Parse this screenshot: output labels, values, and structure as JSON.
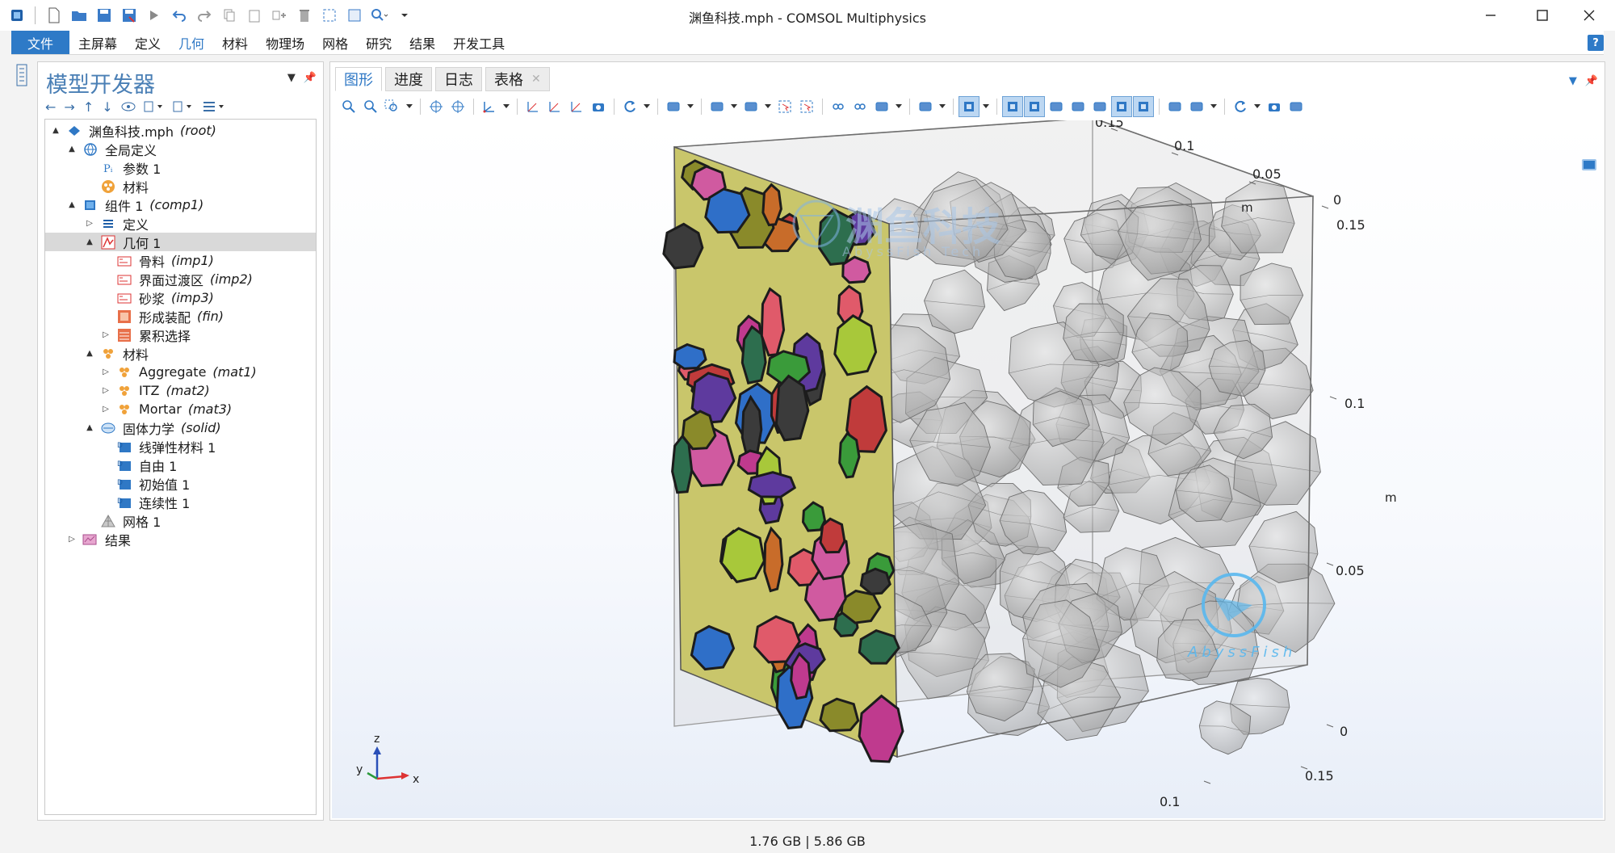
{
  "window": {
    "title": "渊鱼科技.mph - COMSOL Multiphysics",
    "minimize_icon": "minimize-icon",
    "maximize_icon": "maximize-icon",
    "close_icon": "close-icon"
  },
  "menu": {
    "items": [
      "文件",
      "主屏幕",
      "定义",
      "几何",
      "材料",
      "物理场",
      "网格",
      "研究",
      "结果",
      "开发工具"
    ],
    "active": "几何",
    "help": "?"
  },
  "builder": {
    "title": "模型开发器",
    "tree": [
      {
        "label": "渊鱼科技.mph",
        "tag": "(root)",
        "icon": "root-icon",
        "level": 0,
        "toggle": "▲"
      },
      {
        "label": "全局定义",
        "tag": "",
        "icon": "globe-icon",
        "level": 1,
        "toggle": "▲"
      },
      {
        "label": "参数 1",
        "tag": "",
        "icon": "parameters-icon",
        "level": 2,
        "toggle": ""
      },
      {
        "label": "材料",
        "tag": "",
        "icon": "materials-icon",
        "level": 2,
        "toggle": ""
      },
      {
        "label": "组件 1",
        "tag": "(comp1)",
        "icon": "component-icon",
        "level": 1,
        "toggle": "▲"
      },
      {
        "label": "定义",
        "tag": "",
        "icon": "definitions-icon",
        "level": 2,
        "toggle": "▷"
      },
      {
        "label": "几何 1",
        "tag": "",
        "icon": "geometry-icon",
        "level": 2,
        "toggle": "▲",
        "selected": true
      },
      {
        "label": "骨料",
        "tag": "(imp1)",
        "icon": "import-icon",
        "level": 3,
        "toggle": ""
      },
      {
        "label": "界面过渡区",
        "tag": "(imp2)",
        "icon": "import-icon",
        "level": 3,
        "toggle": ""
      },
      {
        "label": "砂浆",
        "tag": "(imp3)",
        "icon": "import-icon",
        "level": 3,
        "toggle": ""
      },
      {
        "label": "形成装配",
        "tag": "(fin)",
        "icon": "form-assembly-icon",
        "level": 3,
        "toggle": ""
      },
      {
        "label": "累积选择",
        "tag": "",
        "icon": "selection-icon",
        "level": 3,
        "toggle": "▷"
      },
      {
        "label": "材料",
        "tag": "",
        "icon": "materials-node-icon",
        "level": 2,
        "toggle": "▲"
      },
      {
        "label": "Aggregate",
        "tag": "(mat1)",
        "icon": "material-icon",
        "level": 3,
        "toggle": "▷"
      },
      {
        "label": "ITZ",
        "tag": "(mat2)",
        "icon": "material-icon",
        "level": 3,
        "toggle": "▷"
      },
      {
        "label": "Mortar",
        "tag": "(mat3)",
        "icon": "material-icon",
        "level": 3,
        "toggle": "▷"
      },
      {
        "label": "固体力学",
        "tag": "(solid)",
        "icon": "solid-mechanics-icon",
        "level": 2,
        "toggle": "▲"
      },
      {
        "label": "线弹性材料 1",
        "tag": "",
        "icon": "physics-node-icon",
        "level": 3,
        "toggle": ""
      },
      {
        "label": "自由 1",
        "tag": "",
        "icon": "physics-node-icon",
        "level": 3,
        "toggle": ""
      },
      {
        "label": "初始值 1",
        "tag": "",
        "icon": "physics-node-icon",
        "level": 3,
        "toggle": ""
      },
      {
        "label": "连续性 1",
        "tag": "",
        "icon": "physics-node-icon",
        "level": 3,
        "toggle": ""
      },
      {
        "label": "网格 1",
        "tag": "",
        "icon": "mesh-icon",
        "level": 2,
        "toggle": ""
      },
      {
        "label": "结果",
        "tag": "",
        "icon": "results-icon",
        "level": 1,
        "toggle": "▷"
      }
    ]
  },
  "graphics": {
    "tabs": [
      "图形",
      "进度",
      "日志",
      "表格"
    ],
    "active_tab": "图形",
    "axis_ticks": {
      "x": [
        "0.1",
        "0.15"
      ],
      "y": [
        "0.15",
        "0.1",
        "0.05",
        "0"
      ],
      "z": [
        "0.15",
        "0.1",
        "0.05",
        "0"
      ],
      "unit": "m"
    },
    "triad": {
      "x": "x",
      "y": "y",
      "z": "z"
    },
    "watermark": "渊鱼科技",
    "watermark_sub": "AbyssFish Tech",
    "logo_text": "AbyssFish"
  },
  "status": {
    "memory": "1.76 GB | 5.86 GB"
  },
  "colors": {
    "accent": "#2e7ac7",
    "builder_title": "#4a7fb5",
    "face": "#c9c66b",
    "particle": "#a9a9a9"
  }
}
